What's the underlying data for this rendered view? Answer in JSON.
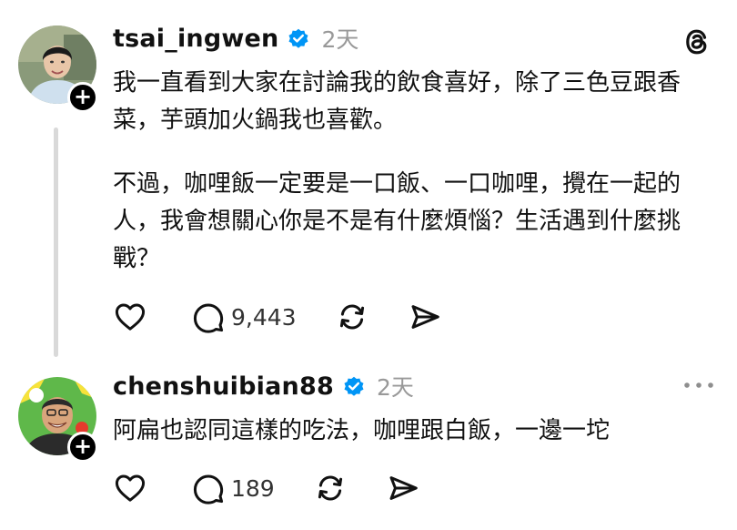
{
  "posts": [
    {
      "username": "tsai_ingwen",
      "timestamp": "2天",
      "paragraphs": [
        "我一直看到大家在討論我的飲食喜好，除了三色豆跟香菜，芋頭加火鍋我也喜歡。",
        "不過，咖哩飯一定要是一口飯、一口咖哩，攪在一起的人，我會想關心你是不是有什麼煩惱？生活遇到什麼挑戰？"
      ],
      "reply_count": "9,443",
      "follow_symbol": "+",
      "icons": {
        "header": "threads-logo-icon",
        "like": "heart-icon",
        "reply": "speech-bubble-icon",
        "repost": "repost-icon",
        "share": "send-icon"
      }
    },
    {
      "username": "chenshuibian88",
      "timestamp": "2天",
      "paragraphs": [
        "阿扁也認同這樣的吃法，咖哩跟白飯，一邊一坨"
      ],
      "reply_count": "189",
      "follow_symbol": "+",
      "icons": {
        "header": "more-dots-icon",
        "like": "heart-icon",
        "reply": "speech-bubble-icon",
        "repost": "repost-icon",
        "share": "send-icon"
      }
    }
  ],
  "colors": {
    "verified_badge": "#0095f6",
    "timestamp": "#999999",
    "thread_line": "#d9d9d9",
    "text": "#111111"
  }
}
